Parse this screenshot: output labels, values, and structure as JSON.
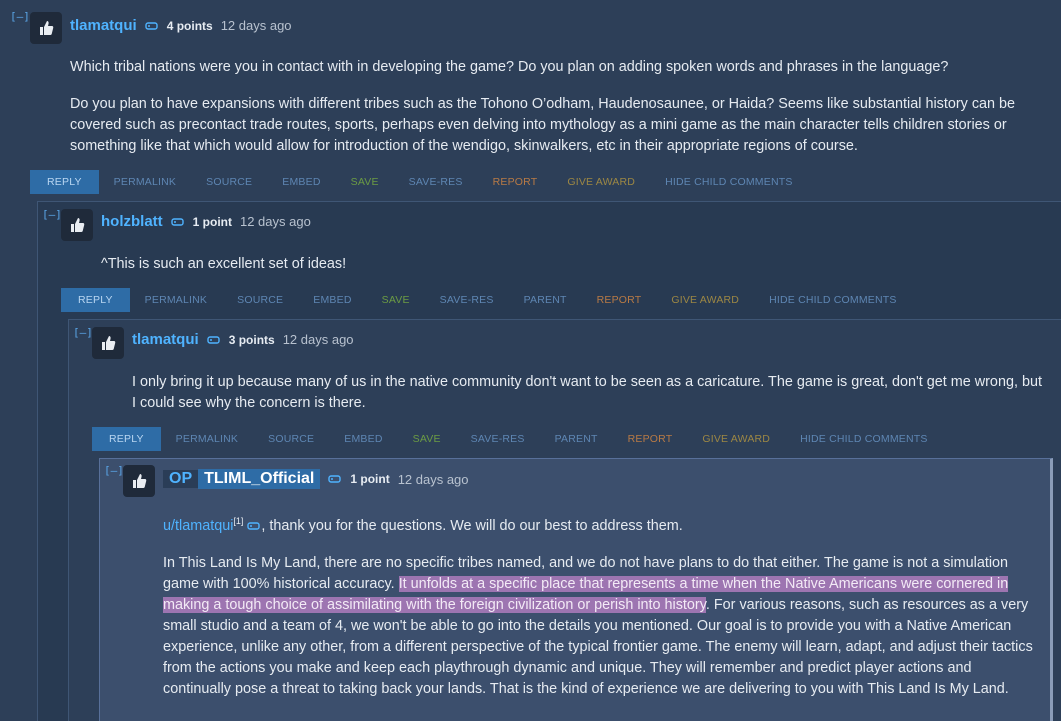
{
  "comments": [
    {
      "collapse": "[–]",
      "author": "tlamatqui",
      "points": "4 points",
      "time": "12 days ago",
      "paragraphs": [
        "Which tribal nations were you in contact with in developing the game? Do you plan on adding spoken words and phrases in the language?",
        "Do you plan to have expansions with different tribes such as the Tohono O’odham, Haudenosaunee, or Haida? Seems like substantial history can be covered such as precontact trade routes, sports, perhaps even delving into mythology as a mini game as the main character tells children stories or something like that which would allow for introduction of the wendigo, skinwalkers, etc in their appropriate regions of course."
      ],
      "buttons": [
        "REPLY",
        "PERMALINK",
        "SOURCE",
        "EMBED",
        "SAVE",
        "SAVE-RES",
        "REPORT",
        "GIVE AWARD",
        "HIDE CHILD COMMENTS"
      ]
    },
    {
      "collapse": "[–]",
      "author": "holzblatt",
      "points": "1 point",
      "time": "12 days ago",
      "paragraphs": [
        "^This is such an excellent set of ideas!"
      ],
      "buttons": [
        "REPLY",
        "PERMALINK",
        "SOURCE",
        "EMBED",
        "SAVE",
        "SAVE-RES",
        "PARENT",
        "REPORT",
        "GIVE AWARD",
        "HIDE CHILD COMMENTS"
      ]
    },
    {
      "collapse": "[–]",
      "author": "tlamatqui",
      "points": "3 points",
      "time": "12 days ago",
      "paragraphs": [
        "I only bring it up because many of us in the native community don't want to be seen as a caricature. The game is great, don't get me wrong, but I could see why the concern is there."
      ],
      "buttons": [
        "REPLY",
        "PERMALINK",
        "SOURCE",
        "EMBED",
        "SAVE",
        "SAVE-RES",
        "PARENT",
        "REPORT",
        "GIVE AWARD",
        "HIDE CHILD COMMENTS"
      ]
    },
    {
      "collapse": "[–]",
      "op_badge": "OP",
      "author": "TLIML_Official",
      "points": "1 point",
      "time": "12 days ago",
      "mention": "u/tlamatqui",
      "mention_sup": "[1]",
      "first_line_rest": ", thank you for the questions. We will do our best to address them.",
      "p2_start": "In This Land Is My Land, there are no specific tribes named, and we do not have plans to do that either. The game is not a simulation game with 100% historical accuracy. ",
      "p2_highlight": "It unfolds at a specific place that represents a time when the Native Americans were cornered in making a tough choice of assimilating with the foreign civilization or perish into history",
      "p2_end": ". For various reasons, such as resources as a very small studio and a team of 4, we won't be able to go into the details you mentioned. Our goal is to provide you with a Native American experience, unlike any other, from a different perspective of the typical frontier game. The enemy will learn, adapt, and adjust their tactics from the actions you make and keep each playthrough dynamic and unique. They will remember and predict player actions and continually pose a threat to taking back your lands. That is the kind of experience we are delivering to you with This Land Is My Land."
    }
  ],
  "colors": {
    "author": "#4fb3ff",
    "reply_bg": "#2e6ca6",
    "highlight": "#b88cc4"
  }
}
